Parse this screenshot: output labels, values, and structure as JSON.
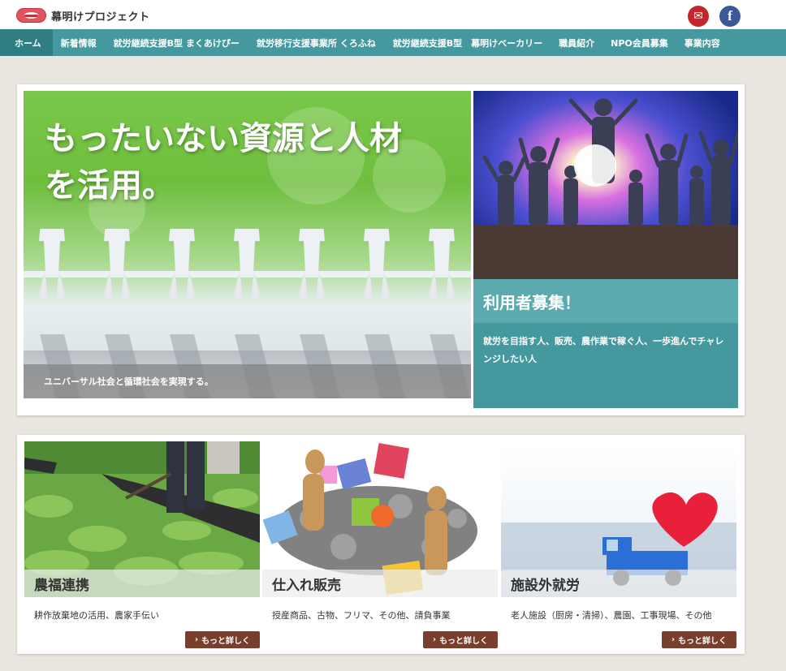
{
  "header": {
    "logo_text": "幕明けプロジェクト",
    "social": [
      {
        "name": "mail",
        "icon": "envelope-icon",
        "glyph": "✉",
        "color": "#c1272d"
      },
      {
        "name": "facebook",
        "icon": "facebook-icon",
        "glyph": "f",
        "color": "#3b5998"
      }
    ]
  },
  "nav": {
    "active_color": "#2f7e83",
    "bar_color": "#45999e",
    "items": [
      {
        "label": "ホーム",
        "active": true
      },
      {
        "label": "新着情報"
      },
      {
        "label": "就労継続支援B型 まくあけぴー"
      },
      {
        "label": "就労移行支援事業所 くろふね"
      },
      {
        "label": "就労継続支援B型　幕明けベーカリー"
      },
      {
        "label": "職員紹介"
      },
      {
        "label": "NPO会員募集"
      },
      {
        "label": "事業内容"
      }
    ]
  },
  "hero": {
    "heading_line1": "もったいない資源と人材",
    "heading_line2": "を活用。",
    "caption": "ユニバーサル社会と循環社会を実現する。",
    "side": {
      "title": "利用者募集！",
      "description": "就労を目指す人、販売、農作業で稼ぐ人、一歩進んでチャレンジしたい人"
    }
  },
  "cards": [
    {
      "title": "農福連携",
      "description": "耕作放棄地の活用、農家手伝い",
      "button": "もっと詳しく"
    },
    {
      "title": "仕入れ販売",
      "description": "授産商品、古物、フリマ、その他、請負事業",
      "button": "もっと詳しく"
    },
    {
      "title": "施設外就労",
      "description": "老人施設（厨房・清掃）、農園、工事現場、その他",
      "button": "もっと詳しく"
    }
  ],
  "colors": {
    "teal": "#45999e",
    "button_brown": "#7a3f2c",
    "background": "#e9e5df"
  }
}
